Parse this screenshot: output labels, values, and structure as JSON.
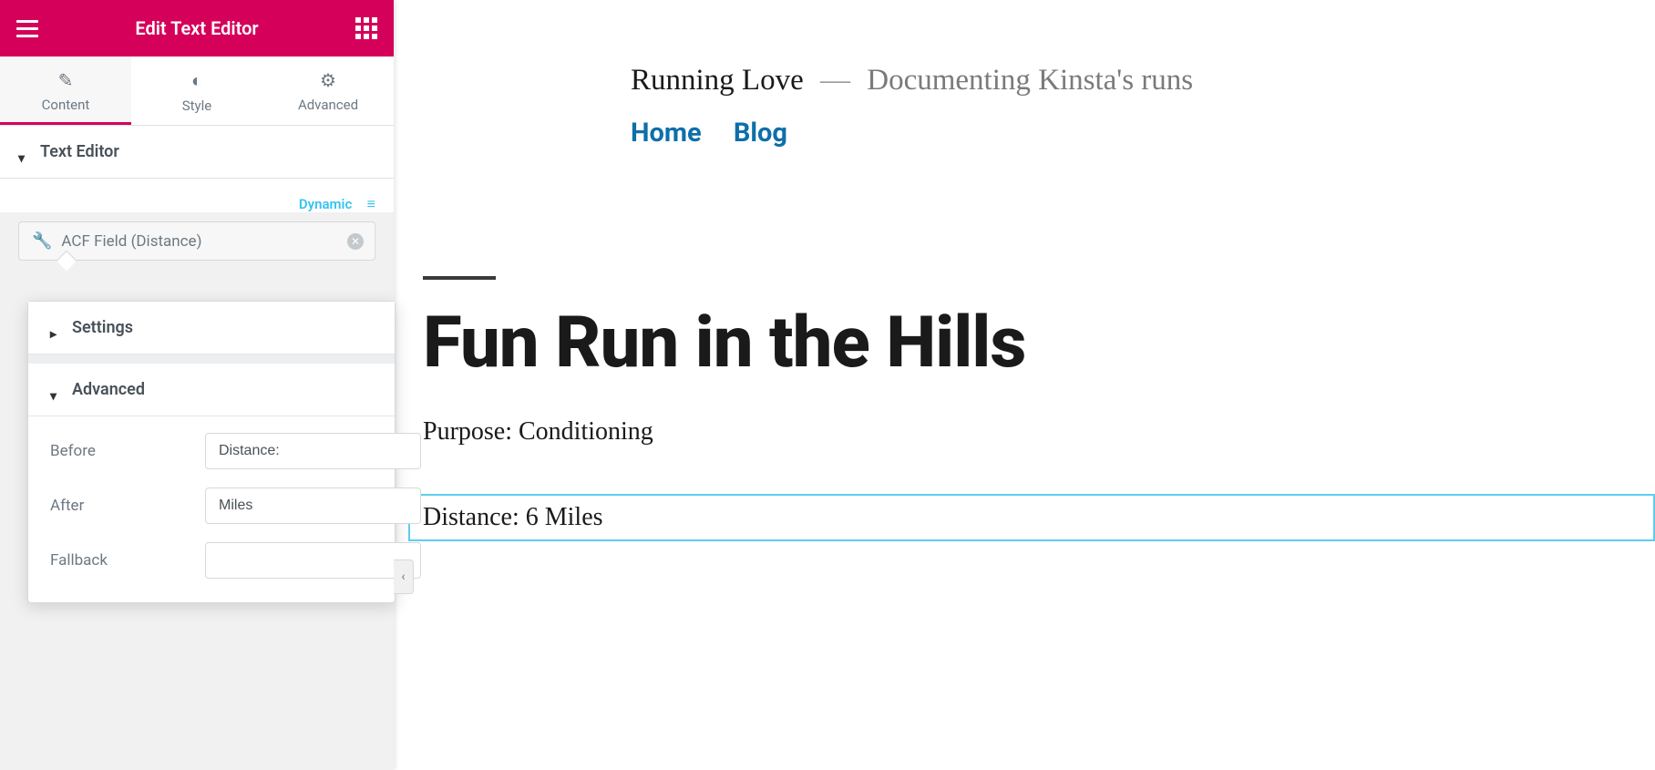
{
  "topbar": {
    "title": "Edit Text Editor"
  },
  "tabs": {
    "content": "Content",
    "style": "Style",
    "advanced": "Advanced"
  },
  "sections": {
    "text_editor": "Text Editor",
    "settings": "Settings",
    "advanced": "Advanced"
  },
  "dynamic_label": "Dynamic",
  "acf_field_label": "ACF Field (Distance)",
  "form": {
    "before_label": "Before",
    "before_value": "Distance:",
    "after_label": "After",
    "after_value": "Miles",
    "fallback_label": "Fallback",
    "fallback_value": ""
  },
  "preview": {
    "site_title": "Running Love",
    "tagline_dash": "—",
    "tagline": "Documenting Kinsta's runs",
    "nav_home": "Home",
    "nav_blog": "Blog",
    "post_title": "Fun Run in the Hills",
    "purpose": "Purpose: Conditioning",
    "distance": "Distance: 6 Miles"
  }
}
